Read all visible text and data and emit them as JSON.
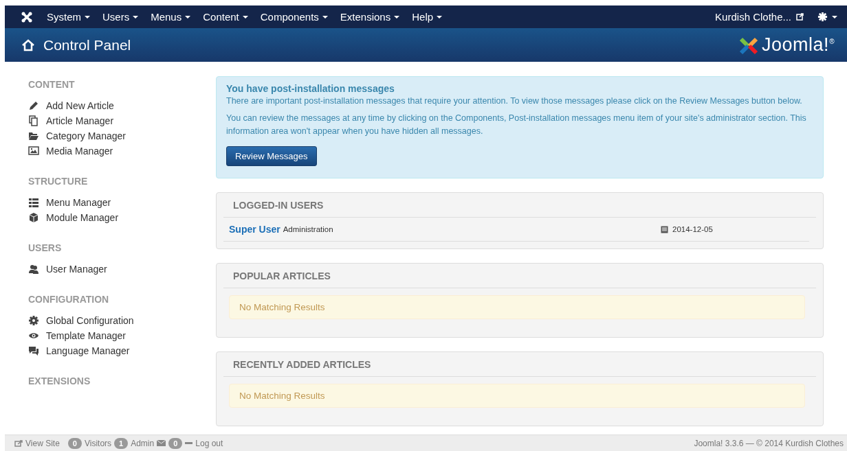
{
  "top_menu": {
    "items": [
      {
        "label": "System"
      },
      {
        "label": "Users"
      },
      {
        "label": "Menus"
      },
      {
        "label": "Content"
      },
      {
        "label": "Components"
      },
      {
        "label": "Extensions"
      },
      {
        "label": "Help"
      }
    ],
    "site_link": "Kurdish Clothe..."
  },
  "header": {
    "title": "Control Panel",
    "brand": "Joomla!$^{®}$"
  },
  "sidebar": {
    "sections": [
      {
        "heading": "CONTENT",
        "items": [
          {
            "label": "Add New Article",
            "kind": "pencil"
          },
          {
            "label": "Article Manager",
            "kind": "copies"
          },
          {
            "label": "Category Manager",
            "kind": "folder"
          },
          {
            "label": "Media Manager",
            "kind": "image"
          }
        ]
      },
      {
        "heading": "STRUCTURE",
        "items": [
          {
            "label": "Menu Manager",
            "kind": "list"
          },
          {
            "label": "Module Manager",
            "kind": "cube"
          }
        ]
      },
      {
        "heading": "USERS",
        "items": [
          {
            "label": "User Manager",
            "kind": "users"
          }
        ]
      },
      {
        "heading": "CONFIGURATION",
        "items": [
          {
            "label": "Global Configuration",
            "kind": "gear"
          },
          {
            "label": "Template Manager",
            "kind": "eye"
          },
          {
            "label": "Language Manager",
            "kind": "comments"
          }
        ]
      },
      {
        "heading": "EXTENSIONS"
      }
    ]
  },
  "alert": {
    "title": "You have post-installation messages",
    "paragraphs": [
      "There are important post-installation messages that require your attention. To view those messages please click on the Review Messages button below.",
      "You can review the messages at any time by clicking on the Components, Post-installation messages menu item of your site's administrator section. This information area won't appear when you have hidden all messages."
    ],
    "button": "Review Messages"
  },
  "panels": [
    {
      "title": "LOGGED-IN USERS",
      "rows": [
        {
          "name": "Super User",
          "role": "Administration",
          "date": "2014-12-05"
        }
      ]
    },
    {
      "title": "POPULAR ARTICLES",
      "empty": "No Matching Results"
    },
    {
      "title": "RECENTLY ADDED ARTICLES",
      "empty": "No Matching Results"
    }
  ],
  "status_bar": {
    "view_site": "View Site",
    "visitors_count": "0",
    "visitors_label": "Visitors",
    "admin_count": "1",
    "admin_label": "Admin",
    "messages_count": "0",
    "logout": "Log out",
    "version": "Joomla! 3.3.6 — © 2014 Kurdish Clothes"
  }
}
